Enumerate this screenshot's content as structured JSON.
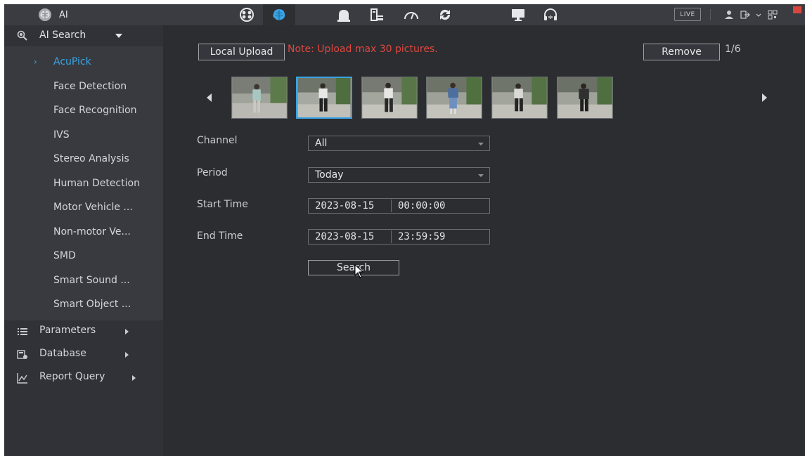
{
  "header": {
    "app_label": "AI",
    "nav_icons": [
      "camera-grid-icon",
      "ai-brain-icon",
      "bell-alarm-icon",
      "storage-icon",
      "speedometer-icon",
      "refresh-icon",
      "monitor-icon",
      "headset-icon"
    ],
    "live_label": "LIVE"
  },
  "sidebar": {
    "section_title": "AI Search",
    "items": [
      {
        "label": "AcuPick",
        "active": true
      },
      {
        "label": "Face Detection"
      },
      {
        "label": "Face Recognition"
      },
      {
        "label": "IVS"
      },
      {
        "label": "Stereo Analysis"
      },
      {
        "label": "Human Detection"
      },
      {
        "label": "Motor Vehicle ..."
      },
      {
        "label": "Non-motor Ve..."
      },
      {
        "label": "SMD"
      },
      {
        "label": "Smart Sound ..."
      },
      {
        "label": "Smart Object ..."
      }
    ],
    "nav": [
      {
        "label": "Parameters",
        "icon": "list-icon"
      },
      {
        "label": "Database",
        "icon": "database-icon"
      },
      {
        "label": "Report Query",
        "icon": "chart-icon"
      }
    ]
  },
  "upload": {
    "button_label": "Local Upload",
    "note": "Note: Upload max 30 pictures.",
    "remove_label": "Remove",
    "pager": "1/6",
    "thumbnail_count": 6,
    "selected_index": 1
  },
  "form": {
    "channel": {
      "label": "Channel",
      "value": "All"
    },
    "period": {
      "label": "Period",
      "value": "Today"
    },
    "start_time": {
      "label": "Start Time",
      "date": "2023-08-15",
      "time": "00:00:00"
    },
    "end_time": {
      "label": "End Time",
      "date": "2023-08-15",
      "time": "23:59:59"
    },
    "search_label": "Search"
  },
  "colors": {
    "accent": "#3aa3e3",
    "warning": "#e0473f",
    "background": "#2b2d31"
  }
}
